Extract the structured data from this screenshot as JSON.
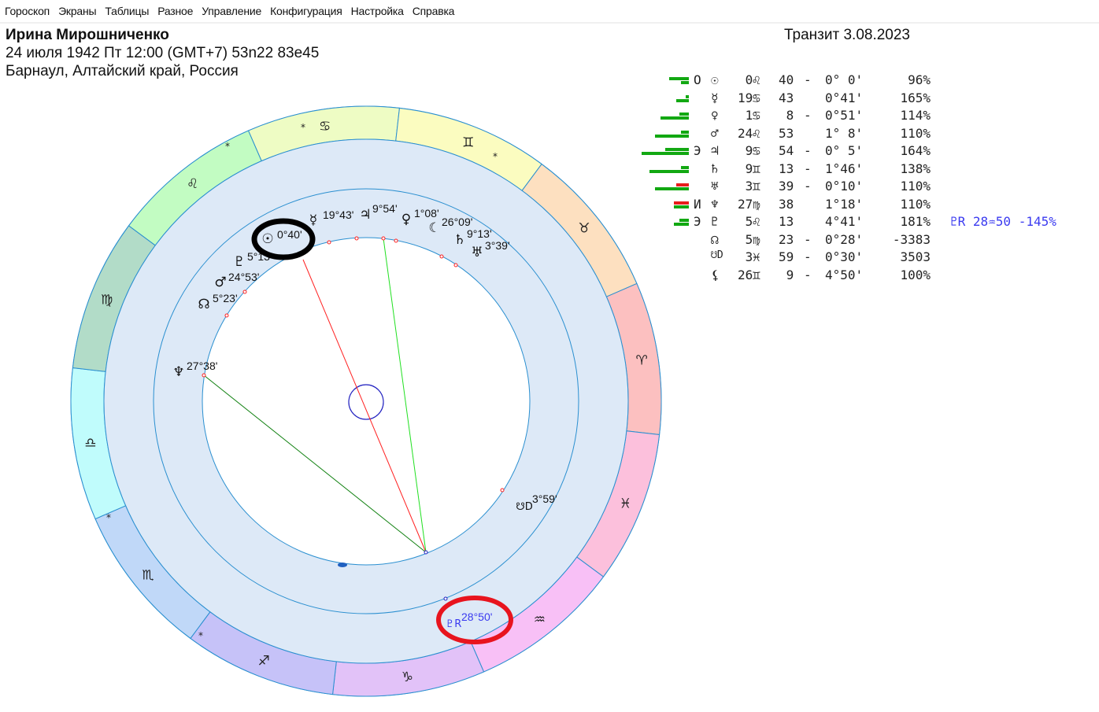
{
  "menu": [
    "Гороскоп",
    "Экраны",
    "Таблицы",
    "Разное",
    "Управление",
    "Конфигурация",
    "Настройка",
    "Справка"
  ],
  "header": {
    "name": "Ирина Мирошниченко",
    "birth": "24 июля 1942  Пт  12:00 (GMT+7) 53n22  83e45",
    "place": "Барнаул, Алтайский край, Россия",
    "transit": "Транзит  3.08.2023"
  },
  "colors": {
    "ring": "#dde9f7",
    "circle_line": "#2a8fd0",
    "highlight_black": "#000000",
    "highlight_red": "#e8141e",
    "retro_blue": "#3a3af0",
    "bar_green": "#12a812",
    "bar_red": "#e81c1c"
  },
  "zodiac": [
    {
      "sign": "cancer",
      "glyph": "♋",
      "color": "#eefcc4"
    },
    {
      "sign": "gemini",
      "glyph": "♊",
      "color": "#fbfcc0"
    },
    {
      "sign": "taurus",
      "glyph": "♉",
      "color": "#fde0c0"
    },
    {
      "sign": "aries",
      "glyph": "♈",
      "color": "#fcc0c0"
    },
    {
      "sign": "pisces",
      "glyph": "♓",
      "color": "#fcc0dc"
    },
    {
      "sign": "aquarius",
      "glyph": "♒",
      "color": "#f8c0f6"
    },
    {
      "sign": "capricorn",
      "glyph": "♑",
      "color": "#e2c2f8"
    },
    {
      "sign": "sagittarius",
      "glyph": "♐",
      "color": "#c6c2f8"
    },
    {
      "sign": "scorpio",
      "glyph": "♏",
      "color": "#c0d8f8"
    },
    {
      "sign": "libra",
      "glyph": "♎",
      "color": "#c0fcfc"
    },
    {
      "sign": "virgo",
      "glyph": "♍",
      "color": "#b2dcc8"
    },
    {
      "sign": "leo",
      "glyph": "♌",
      "color": "#c2fcc2"
    }
  ],
  "zodiac_marks": [
    "*",
    "*",
    "*",
    "*",
    "*"
  ],
  "wheel_planets": [
    {
      "planet": "sun",
      "glyph": "☉",
      "label": "0°40'"
    },
    {
      "planet": "mercury",
      "glyph": "☿",
      "label": "19°43'"
    },
    {
      "planet": "jupiter",
      "glyph": "♃",
      "label": "9°54'"
    },
    {
      "planet": "venus",
      "glyph": "♀",
      "label": "1°08'"
    },
    {
      "planet": "moon",
      "glyph": "☾",
      "label": "26°09'"
    },
    {
      "planet": "saturn",
      "glyph": "♄",
      "label": "9°13'"
    },
    {
      "planet": "uranus",
      "glyph": "♅",
      "label": "3°39'"
    },
    {
      "planet": "pluto",
      "glyph": "♇",
      "label": "5°13'"
    },
    {
      "planet": "mars",
      "glyph": "♂",
      "label": "24°53'"
    },
    {
      "planet": "north-node",
      "glyph": "☊",
      "label": "5°23'"
    },
    {
      "planet": "neptune",
      "glyph": "♆",
      "label": "27°38'"
    },
    {
      "planet": "south-node",
      "glyph": "☋D",
      "label": "3°59'"
    },
    {
      "planet": "transit-pluto",
      "glyph": "♇R",
      "label": "28°50'"
    }
  ],
  "table": [
    {
      "mark": "О",
      "glyph": "☉",
      "deg": " 0",
      "sign": "♌",
      "min": "40",
      "dash": "-",
      "orb": "0° 0'",
      "pct": "96%",
      "bars": [
        {
          "v": 25,
          "c": "green"
        },
        {
          "v": 10,
          "c": "green"
        }
      ]
    },
    {
      "mark": "",
      "glyph": "☿",
      "deg": "19",
      "sign": "♋",
      "min": "43",
      "dash": "",
      "orb": "0°41'",
      "pct": "165%",
      "bars": [
        {
          "v": 4,
          "c": "green"
        },
        {
          "v": 16,
          "c": "green"
        }
      ]
    },
    {
      "mark": "",
      "glyph": "♀",
      "deg": " 1",
      "sign": "♋",
      "min": " 8",
      "dash": "-",
      "orb": "0°51'",
      "pct": "114%",
      "bars": [
        {
          "v": 12,
          "c": "green"
        },
        {
          "v": 36,
          "c": "green"
        }
      ]
    },
    {
      "mark": "",
      "glyph": "♂",
      "deg": "24",
      "sign": "♌",
      "min": "53",
      "dash": "",
      "orb": "1° 8'",
      "pct": "110%",
      "bars": [
        {
          "v": 10,
          "c": "green"
        },
        {
          "v": 43,
          "c": "green"
        }
      ]
    },
    {
      "mark": "Э",
      "glyph": "♃",
      "deg": " 9",
      "sign": "♋",
      "min": "54",
      "dash": "-",
      "orb": "0° 5'",
      "pct": "164%",
      "bars": [
        {
          "v": 30,
          "c": "green"
        },
        {
          "v": 60,
          "c": "green"
        }
      ]
    },
    {
      "mark": "",
      "glyph": "♄",
      "deg": " 9",
      "sign": "♊",
      "min": "13",
      "dash": "-",
      "orb": "1°46'",
      "pct": "138%",
      "bars": [
        {
          "v": 10,
          "c": "green"
        },
        {
          "v": 50,
          "c": "green"
        }
      ]
    },
    {
      "mark": "",
      "glyph": "♅",
      "deg": " 3",
      "sign": "♊",
      "min": "39",
      "dash": "-",
      "orb": "0°10'",
      "pct": "110%",
      "bars": [
        {
          "v": 16,
          "c": "red"
        },
        {
          "v": 43,
          "c": "green"
        }
      ]
    },
    {
      "mark": "И",
      "glyph": "♆",
      "deg": "27",
      "sign": "♍",
      "min": "38",
      "dash": "",
      "orb": "1°18'",
      "pct": "110%",
      "bars": [
        {
          "v": 19,
          "c": "red"
        },
        {
          "v": 19,
          "c": "green"
        }
      ]
    },
    {
      "mark": "Э",
      "glyph": "♇",
      "deg": " 5",
      "sign": "♌",
      "min": "13",
      "dash": "",
      "orb": "4°41'",
      "pct": "181%",
      "bars": [
        {
          "v": 12,
          "c": "green"
        },
        {
          "v": 19,
          "c": "green"
        }
      ],
      "extra": "♇R 28♒50 -145%"
    },
    {
      "mark": "",
      "glyph": "☊",
      "deg": " 5",
      "sign": "♍",
      "min": "23",
      "dash": "-",
      "orb": "0°28'",
      "pct": "-3383",
      "bars": []
    },
    {
      "mark": "",
      "glyph": "☋D",
      "deg": " 3",
      "sign": "♓",
      "min": "59",
      "dash": "-",
      "orb": "0°30'",
      "pct": "3503",
      "bars": []
    },
    {
      "mark": "",
      "glyph": "⚸",
      "deg": "26",
      "sign": "♊",
      "min": " 9",
      "dash": "-",
      "orb": "4°50'",
      "pct": "100%",
      "bars": []
    }
  ]
}
